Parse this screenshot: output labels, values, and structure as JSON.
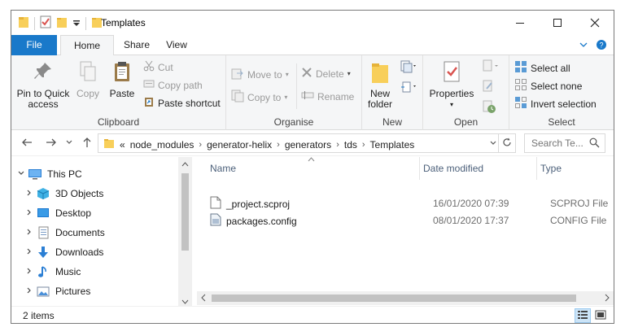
{
  "window": {
    "title": "Templates"
  },
  "ribbon_tabs": [
    {
      "label": "File"
    },
    {
      "label": "Home"
    },
    {
      "label": "Share"
    },
    {
      "label": "View"
    }
  ],
  "clipboard": {
    "pin_label": "Pin to Quick access",
    "copy_label": "Copy",
    "paste_label": "Paste",
    "cut_label": "Cut",
    "copy_path_label": "Copy path",
    "paste_shortcut_label": "Paste shortcut",
    "group_label": "Clipboard"
  },
  "organise": {
    "move_to_label": "Move to",
    "copy_to_label": "Copy to",
    "delete_label": "Delete",
    "rename_label": "Rename",
    "group_label": "Organise"
  },
  "new_group": {
    "new_folder_label": "New folder",
    "group_label": "New"
  },
  "open_group": {
    "properties_label": "Properties",
    "group_label": "Open"
  },
  "select_group": {
    "select_all_label": "Select all",
    "select_none_label": "Select none",
    "invert_selection_label": "Invert selection",
    "group_label": "Select"
  },
  "address": {
    "overflow": "«",
    "crumbs": [
      "node_modules",
      "generator-helix",
      "generators",
      "tds",
      "Templates"
    ]
  },
  "search": {
    "placeholder": "Search Te..."
  },
  "nav_pane": {
    "items": [
      {
        "label": "This PC",
        "icon": "computer-icon"
      },
      {
        "label": "3D Objects",
        "icon": "cube-icon"
      },
      {
        "label": "Desktop",
        "icon": "desktop-icon"
      },
      {
        "label": "Documents",
        "icon": "documents-icon"
      },
      {
        "label": "Downloads",
        "icon": "download-icon"
      },
      {
        "label": "Music",
        "icon": "music-icon"
      },
      {
        "label": "Pictures",
        "icon": "pictures-icon"
      }
    ]
  },
  "file_list": {
    "columns": [
      "Name",
      "Date modified",
      "Type"
    ],
    "rows": [
      {
        "name": "_project.scproj",
        "date": "16/01/2020 07:39",
        "type": "SCPROJ File"
      },
      {
        "name": "packages.config",
        "date": "08/01/2020 17:37",
        "type": "CONFIG File"
      }
    ]
  },
  "status": {
    "item_count": "2 items"
  },
  "colors": {
    "accent": "#1979ca",
    "ribbon_bg": "#f5f6f7",
    "folder_yellow": "#f8cf5a"
  }
}
